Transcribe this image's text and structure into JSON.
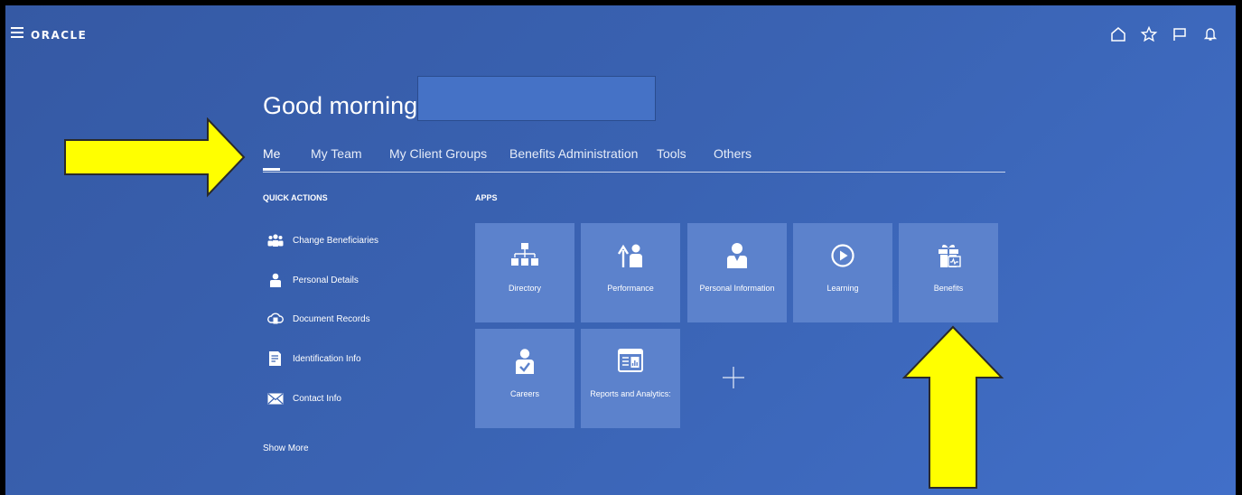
{
  "header": {
    "logo_text": "ORACLE",
    "icons": [
      "home-icon",
      "star-icon",
      "flag-icon",
      "bell-icon"
    ]
  },
  "greeting": "Good morning,",
  "tabs": [
    {
      "label": "Me",
      "active": true
    },
    {
      "label": "My Team"
    },
    {
      "label": "My Client Groups"
    },
    {
      "label": "Benefits Administration"
    },
    {
      "label": "Tools"
    },
    {
      "label": "Others"
    }
  ],
  "quick_actions": {
    "title": "QUICK ACTIONS",
    "items": [
      {
        "label": "Change Beneficiaries",
        "icon": "people-icon"
      },
      {
        "label": "Personal Details",
        "icon": "person-icon"
      },
      {
        "label": "Document Records",
        "icon": "cloud-document-icon"
      },
      {
        "label": "Identification Info",
        "icon": "id-document-icon"
      },
      {
        "label": "Contact Info",
        "icon": "envelope-icon"
      }
    ],
    "show_more": "Show More"
  },
  "apps": {
    "title": "APPS",
    "tiles": [
      {
        "label": "Directory",
        "icon": "org-chart-icon"
      },
      {
        "label": "Performance",
        "icon": "performance-icon"
      },
      {
        "label": "Personal Information",
        "icon": "person-icon"
      },
      {
        "label": "Learning",
        "icon": "play-icon"
      },
      {
        "label": "Benefits",
        "icon": "gift-icon"
      },
      {
        "label": "Careers",
        "icon": "career-icon"
      },
      {
        "label": "Reports and Analytics:",
        "icon": "report-icon"
      }
    ]
  },
  "colors": {
    "background": "#3a63b3",
    "tile": "#5c82cc",
    "annotation_arrow": "#ffff00"
  }
}
